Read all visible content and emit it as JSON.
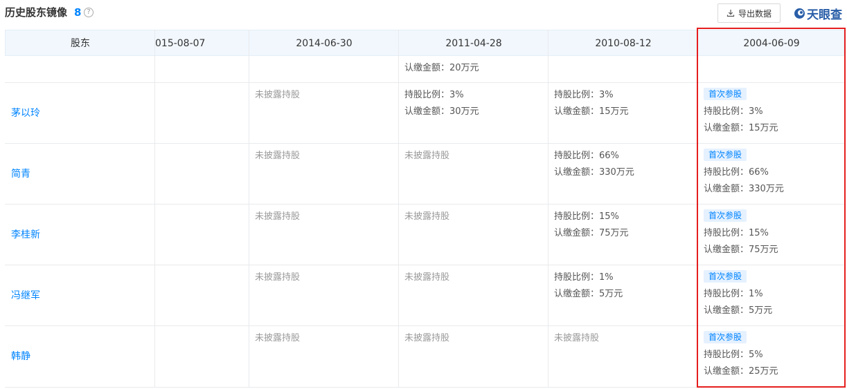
{
  "header": {
    "title": "历史股东镜像",
    "count": "8",
    "help_icon": "?",
    "export_label": "导出数据",
    "logo_text": "天眼查"
  },
  "columns": {
    "shareholder": "股东",
    "d1": "015-08-07",
    "d2": "2014-06-30",
    "d3": "2011-04-28",
    "d4": "2010-08-12",
    "d5": "2004-06-09"
  },
  "partial_row": {
    "d3_amount": "认缴金额：20万元"
  },
  "rows": [
    {
      "name": "茅以玲",
      "d2": "未披露持股",
      "d3_ratio": "持股比例：3%",
      "d3_amount": "认缴金额：30万元",
      "d4_ratio": "持股比例：3%",
      "d4_amount": "认缴金额：15万元",
      "d5_badge": "首次参股",
      "d5_ratio": "持股比例：3%",
      "d5_amount": "认缴金额：15万元"
    },
    {
      "name": "简青",
      "d2": "未披露持股",
      "d3": "未披露持股",
      "d4_ratio": "持股比例：66%",
      "d4_amount": "认缴金额：330万元",
      "d5_badge": "首次参股",
      "d5_ratio": "持股比例：66%",
      "d5_amount": "认缴金额：330万元"
    },
    {
      "name": "李桂新",
      "d2": "未披露持股",
      "d3": "未披露持股",
      "d4_ratio": "持股比例：15%",
      "d4_amount": "认缴金额：75万元",
      "d5_badge": "首次参股",
      "d5_ratio": "持股比例：15%",
      "d5_amount": "认缴金额：75万元"
    },
    {
      "name": "冯继军",
      "d2": "未披露持股",
      "d3": "未披露持股",
      "d4_ratio": "持股比例：1%",
      "d4_amount": "认缴金额：5万元",
      "d5_badge": "首次参股",
      "d5_ratio": "持股比例：1%",
      "d5_amount": "认缴金额：5万元"
    },
    {
      "name": "韩静",
      "d2": "未披露持股",
      "d3": "未披露持股",
      "d4": "未披露持股",
      "d5_badge": "首次参股",
      "d5_ratio": "持股比例：5%",
      "d5_amount": "认缴金额：25万元"
    }
  ],
  "colors": {
    "link_blue": "#0084ff",
    "header_bg": "#f2f7fe",
    "badge_bg": "#e5f1ff",
    "highlight_red": "#e51d1d",
    "muted_text": "#999999"
  }
}
